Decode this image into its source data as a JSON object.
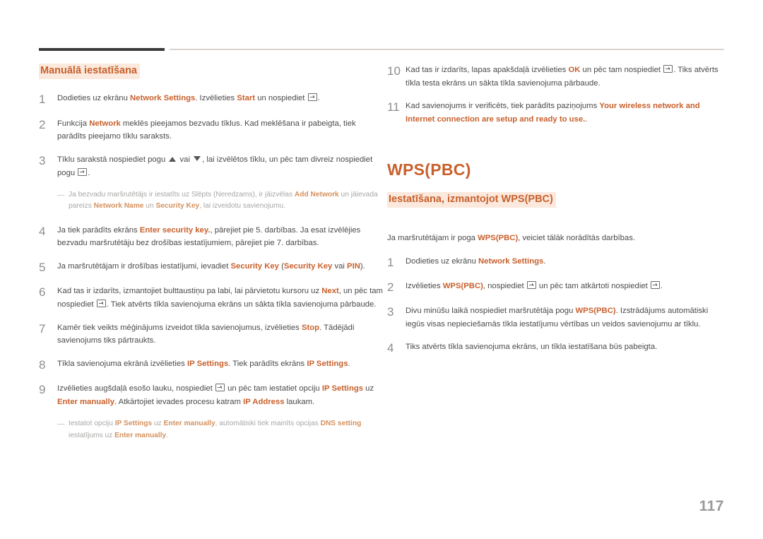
{
  "page": {
    "number": "117"
  },
  "left": {
    "section_title": "Manuālā iestatīšana",
    "steps": [
      {
        "num": "1",
        "html": "Dodieties uz ekrānu <b>Network Settings</b>. Izvēlieties <b>Start</b> un nospiediet <span class=\"kbd\"></span>."
      },
      {
        "num": "2",
        "html": "Funkcija <b>Network</b> meklēs pieejamos bezvadu tīklus. Kad meklēšana ir pabeigta, tiek parādīts pieejamo tīklu saraksts."
      },
      {
        "num": "3",
        "html": "Tīklu sarakstā nospiediet pogu <span class=\"arrow-up\"></span> vai <span class=\"arrow-down\"></span>, lai izvēlētos tīklu, un pēc tam divreiz nospiediet pogu <span class=\"kbd\"></span>."
      },
      {
        "num": "4",
        "html": "Ja tiek parādīts ekrāns <b>Enter security key.</b>, pārejiet pie 5. darbības. Ja esat izvēlējies bezvadu maršrutētāju bez drošības iestatījumiem, pārejiet pie 7. darbības."
      },
      {
        "num": "5",
        "html": "Ja maršrutētājam ir drošības iestatījumi, ievadiet <b>Security Key</b> (<b>Security Key</b> vai <b>PIN</b>)."
      },
      {
        "num": "6",
        "html": "Kad tas ir izdarīts, izmantojiet bulttaustiņu pa labi, lai pārvietotu kursoru uz <b>Next</b>, un pēc tam nospiediet <span class=\"kbd\"></span>. Tiek atvērts tīkla savienojuma ekrāns un sākta tīkla savienojuma pārbaude."
      },
      {
        "num": "7",
        "html": "Kamēr tiek veikts mēģinājums izveidot tīkla savienojumus, izvēlieties <b>Stop</b>. Tādējādi savienojums tiks pārtraukts."
      },
      {
        "num": "8",
        "html": "Tīkla savienojuma ekrānā izvēlieties <b>IP Settings</b>. Tiek parādīts ekrāns <b>IP Settings</b>."
      },
      {
        "num": "9",
        "html": "Izvēlieties augšdaļā esošo lauku, nospiediet <span class=\"kbd\"></span> un pēc tam iestatiet opciju <b>IP Settings</b> uz <b>Enter manually</b>. Atkārtojiet ievades procesu katram <b>IP Address</b> laukam."
      }
    ],
    "note_after_3": "Ja bezvadu maršrutētājs ir iestatīts uz Slēpts (Neredzams), ir jāizvēlas <b>Add Network</b> un jāievada pareizs <b>Network Name</b> un <b>Security Key</b>, lai izveidotu savienojumu.",
    "note_after_9": "Iestatot opciju <b>IP Settings</b> uz <b>Enter manually</b>, automātiski tiek mainīts opcijas <b>DNS setting</b> iestatījums uz <b>Enter manually</b>."
  },
  "right": {
    "steps_top": [
      {
        "num": "10",
        "html": "Kad tas ir izdarīts, lapas apakšdaļā izvēlieties <b>OK</b> un pēc tam nospiediet <span class=\"kbd\"></span>. Tiks atvērts tīkla testa ekrāns un sākta tīkla savienojuma pārbaude."
      },
      {
        "num": "11",
        "html": "Kad savienojums ir verificēts, tiek parādīts paziņojums <b>Your wireless network and Internet connection are setup and ready to use.</b>."
      }
    ],
    "big_title": "WPS(PBC)",
    "section_title": "Iestatīšana, izmantojot WPS(PBC)",
    "intro": "Ja maršrutētājam ir poga <b>WPS(PBC)</b>, veiciet tālāk norādītās darbības.",
    "steps": [
      {
        "num": "1",
        "html": "Dodieties uz ekrānu <b>Network Settings</b>."
      },
      {
        "num": "2",
        "html": "Izvēlieties <b>WPS(PBC)</b>, nospiediet <span class=\"kbd\"></span> un pēc tam atkārtoti nospiediet <span class=\"kbd\"></span>."
      },
      {
        "num": "3",
        "html": "Divu minūšu laikā nospiediet maršrutētāja pogu <b>WPS(PBC)</b>. Izstrādājums automātiski iegūs visas nepieciešamās tīkla iestatījumu vērtības un veidos savienojumu ar tīklu."
      },
      {
        "num": "4",
        "html": "Tiks atvērts tīkla savienojuma ekrāns, un tīkla iestatīšana būs pabeigta."
      }
    ]
  }
}
